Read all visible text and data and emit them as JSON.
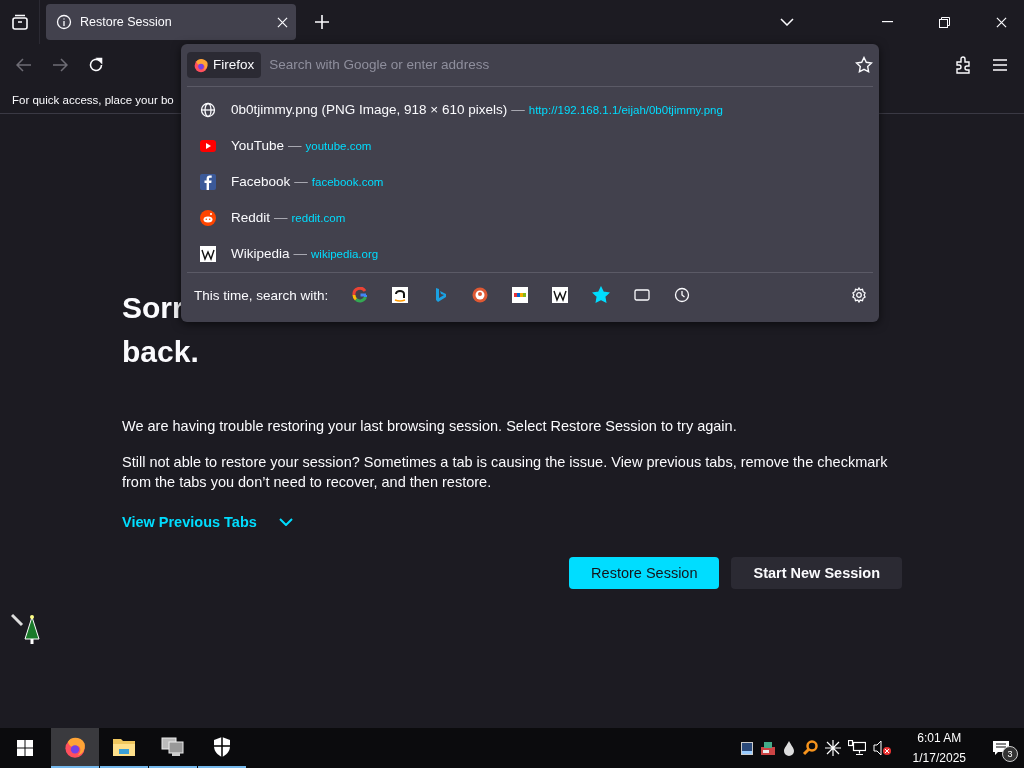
{
  "tabs": [
    {
      "label": "Restore Session",
      "selected": true
    }
  ],
  "url_bar": {
    "identity": "Firefox",
    "placeholder": "Search with Google or enter address"
  },
  "bookmarks_bar": {
    "text": "For quick access, place your bo"
  },
  "suggestions": [
    {
      "kind": "page",
      "title": "0b0tjimmy.png (PNG Image, 918 × 610 pixels)",
      "separator": "—",
      "url": "http://192.168.1.1/eijah/0b0tjimmy.png"
    },
    {
      "kind": "youtube",
      "title": "YouTube",
      "separator": "—",
      "url": "youtube.com"
    },
    {
      "kind": "facebook",
      "title": "Facebook",
      "separator": "—",
      "url": "facebook.com"
    },
    {
      "kind": "reddit",
      "title": "Reddit",
      "separator": "—",
      "url": "reddit.com"
    },
    {
      "kind": "wikipedia",
      "title": "Wikipedia",
      "separator": "—",
      "url": "wikipedia.org"
    }
  ],
  "search_with": {
    "label": "This time, search with:",
    "engines": [
      {
        "kind": "google"
      },
      {
        "kind": "amazon"
      },
      {
        "kind": "bing"
      },
      {
        "kind": "duckduckgo"
      },
      {
        "kind": "ebay"
      },
      {
        "kind": "wikipedia"
      },
      {
        "kind": "bookmarks"
      },
      {
        "kind": "tabs"
      },
      {
        "kind": "history"
      }
    ]
  },
  "page": {
    "heading_visible": [
      "Sorr",
      "back."
    ],
    "paragraphs": [
      "We are having trouble restoring your last browsing session. Select Restore Session to try again.",
      "Still not able to restore your session? Sometimes a tab is causing the issue. View previous tabs, remove the checkmark from the tabs you don’t need to recover, and then restore."
    ],
    "link": "View Previous Tabs",
    "buttons": [
      {
        "label": "Restore Session",
        "kind": "primary"
      },
      {
        "label": "Start New Session",
        "kind": "secondary"
      }
    ]
  },
  "taskbar": {
    "apps": [
      {
        "kind": "firefox",
        "selected": true
      },
      {
        "kind": "explorer",
        "selected": false
      },
      {
        "kind": "network",
        "selected": false
      },
      {
        "kind": "shield",
        "selected": false
      }
    ],
    "tray": [
      {
        "kind": "tablet"
      },
      {
        "kind": "app"
      },
      {
        "kind": "drop"
      },
      {
        "kind": "magnifier"
      },
      {
        "kind": "asterisk"
      },
      {
        "kind": "network"
      },
      {
        "kind": "volume"
      }
    ],
    "time": "6:01 AM",
    "date": "1/17/2025",
    "notifications": "3"
  }
}
